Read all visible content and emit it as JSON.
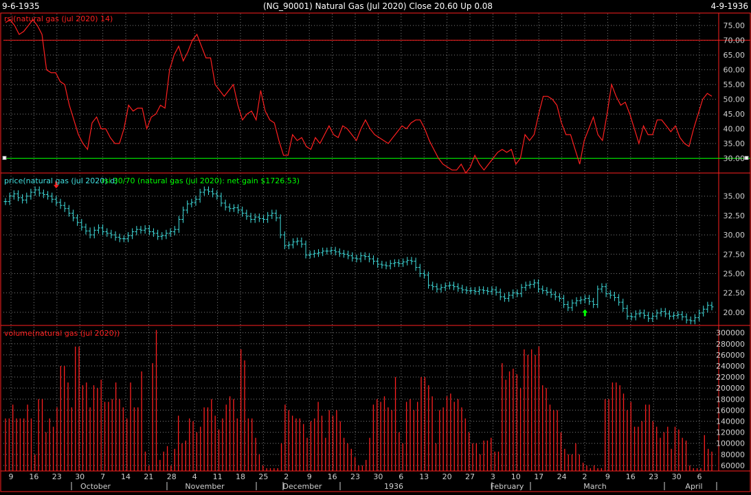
{
  "header": {
    "start_date": "9-6-1935",
    "title": "(NG_90001)  Natural Gas (Jul 2020)    Close 20.60   Up 0.08",
    "end_date": "4-9-1936"
  },
  "colors": {
    "background": "#000000",
    "frame": "#ff2020",
    "grid": "#7f7f7f",
    "rsi_line": "#ff2020",
    "price_bars": "#40e0e0",
    "volume_bars": "#ff2020",
    "threshold_upper": "#ff2020",
    "threshold_lower": "#00ff00",
    "sell_arrow": "#ff2020",
    "buy_arrow": "#00ff00"
  },
  "chart_data": [
    {
      "type": "line",
      "panel": "rsi",
      "title": "rsi(natural gas (jul 2020) 14)",
      "ylim": [
        25,
        79
      ],
      "ticks": [
        "75.00",
        "70.00",
        "65.00",
        "60.00",
        "55.00",
        "50.00",
        "45.00",
        "40.00",
        "35.00",
        "30.00"
      ],
      "thresholds": [
        70,
        30
      ],
      "values": [
        76,
        77,
        75,
        72,
        73,
        75,
        77,
        75,
        72,
        60,
        59,
        59,
        56,
        55,
        48,
        43,
        38,
        35,
        33,
        42,
        44,
        40,
        40,
        37,
        35,
        35,
        40,
        48,
        46,
        47,
        47,
        40,
        44,
        45,
        48,
        47,
        60,
        65,
        68,
        63,
        66,
        70,
        72,
        68,
        64,
        64,
        55,
        53,
        51,
        53,
        55,
        48,
        43,
        45,
        46,
        43,
        53,
        46,
        43,
        42,
        36,
        31,
        31,
        38,
        36,
        37,
        34,
        33,
        37,
        35,
        38,
        41,
        38,
        37,
        41,
        40,
        38,
        36,
        40,
        43,
        40,
        38,
        37,
        36,
        35,
        37,
        39,
        41,
        40,
        42,
        43,
        43,
        40,
        36,
        33,
        30,
        28,
        27,
        26,
        26,
        28,
        25,
        27,
        31,
        28,
        26,
        28,
        30,
        32,
        33,
        32,
        33,
        28,
        30,
        38,
        36,
        38,
        45,
        51,
        51,
        50,
        48,
        42,
        38,
        38,
        33,
        28,
        36,
        40,
        44,
        38,
        36,
        45,
        55,
        51,
        48,
        49,
        45,
        40,
        35,
        41,
        38,
        38,
        43,
        43,
        41,
        39,
        41,
        37,
        35,
        34,
        40,
        45,
        50,
        52,
        51
      ],
      "grid": true
    },
    {
      "type": "ohlc",
      "panel": "price",
      "title": "price(natural gas (jul 2020) d)",
      "subtitle": "rsi 30/70 (natural gas (jul 2020): net gain $1726.53)",
      "ylim": [
        18.3,
        37.9
      ],
      "ticks": [
        "35.00",
        "32.50",
        "30.00",
        "27.50",
        "25.00",
        "22.50",
        "20.00"
      ],
      "closes": [
        34.3,
        35.0,
        35.3,
        34.8,
        34.5,
        35.0,
        35.5,
        35.8,
        35.4,
        35.2,
        35.0,
        34.6,
        34.2,
        33.8,
        33.4,
        32.8,
        32.2,
        31.6,
        31.0,
        30.5,
        30.0,
        30.6,
        30.9,
        30.4,
        30.2,
        30.0,
        29.7,
        29.5,
        29.5,
        29.9,
        30.4,
        30.7,
        30.6,
        30.8,
        30.4,
        30.2,
        29.8,
        29.9,
        30.2,
        30.4,
        30.7,
        32.0,
        33.2,
        34.0,
        34.2,
        34.6,
        35.5,
        35.8,
        35.6,
        35.3,
        35.0,
        34.1,
        33.6,
        33.4,
        33.5,
        33.2,
        32.8,
        32.4,
        32.0,
        32.3,
        32.1,
        32.0,
        32.5,
        32.8,
        32.2,
        30.0,
        28.6,
        28.7,
        29.1,
        29.2,
        28.8,
        27.4,
        27.5,
        27.6,
        27.7,
        27.9,
        27.9,
        28.0,
        27.8,
        27.6,
        27.5,
        27.3,
        27.0,
        26.9,
        27.3,
        27.2,
        26.9,
        26.6,
        26.2,
        26.1,
        26.0,
        26.3,
        26.4,
        26.3,
        26.5,
        26.7,
        26.6,
        25.8,
        25.0,
        24.8,
        23.5,
        23.3,
        23.0,
        23.2,
        23.4,
        23.5,
        23.3,
        23.1,
        22.9,
        22.8,
        22.8,
        22.7,
        22.9,
        22.8,
        22.7,
        22.9,
        22.6,
        22.0,
        21.8,
        22.2,
        22.5,
        22.4,
        23.2,
        23.5,
        23.6,
        23.8,
        23.0,
        22.8,
        22.6,
        22.3,
        22.0,
        21.8,
        21.0,
        20.6,
        21.2,
        21.5,
        21.6,
        21.8,
        21.4,
        21.0,
        23.0,
        23.3,
        22.4,
        22.2,
        21.9,
        21.3,
        20.5,
        19.5,
        19.4,
        19.8,
        19.9,
        19.6,
        19.2,
        19.5,
        19.9,
        20.1,
        19.8,
        19.5,
        19.6,
        19.7,
        19.4,
        19.0,
        18.9,
        19.3,
        19.9,
        20.4,
        20.9,
        20.7
      ],
      "signals": [
        {
          "type": "sell",
          "bar": 12
        },
        {
          "type": "buy",
          "bar": 137
        }
      ],
      "grid": true
    },
    {
      "type": "bar",
      "panel": "volume",
      "title": "volume(natural gas (jul 2020))",
      "ylim": [
        50000,
        312000
      ],
      "ticks": [
        "300000",
        "280000",
        "260000",
        "240000",
        "220000",
        "200000",
        "180000",
        "160000",
        "140000",
        "120000",
        "100000",
        "80000",
        "60000"
      ],
      "values": [
        145000,
        145000,
        170000,
        145000,
        145000,
        145000,
        170000,
        145000,
        80000,
        180000,
        180000,
        120000,
        145000,
        130000,
        165000,
        240000,
        240000,
        210000,
        165000,
        275000,
        275000,
        205000,
        210000,
        165000,
        205000,
        200000,
        215000,
        175000,
        175000,
        180000,
        210000,
        180000,
        165000,
        145000,
        210000,
        165000,
        165000,
        230000,
        85000,
        60000,
        245000,
        305000,
        70000,
        85000,
        95000,
        60000,
        90000,
        150000,
        100000,
        105000,
        145000,
        140000,
        120000,
        130000,
        165000,
        165000,
        180000,
        150000,
        125000,
        145000,
        170000,
        185000,
        180000,
        145000,
        270000,
        250000,
        145000,
        145000,
        110000,
        80000,
        60000,
        55000,
        55000,
        55000,
        55000,
        100000,
        170000,
        160000,
        150000,
        145000,
        145000,
        135000,
        110000,
        140000,
        145000,
        175000,
        150000,
        110000,
        160000,
        150000,
        160000,
        140000,
        110000,
        100000,
        90000,
        75000,
        60000,
        60000,
        70000,
        110000,
        170000,
        180000,
        175000,
        185000,
        165000,
        160000,
        220000,
        120000,
        100000,
        175000,
        180000,
        160000,
        175000,
        220000,
        220000,
        205000,
        185000,
        100000,
        160000,
        165000,
        185000,
        190000,
        175000,
        180000,
        165000,
        145000,
        120000,
        100000,
        100000,
        80000,
        105000,
        105000,
        110000,
        85000,
        85000,
        245000,
        215000,
        230000,
        235000,
        225000,
        200000,
        270000,
        260000,
        270000,
        260000,
        275000,
        205000,
        200000,
        170000,
        160000,
        160000,
        120000,
        90000,
        80000,
        80000,
        100000,
        80000,
        65000,
        60000,
        55000,
        60000,
        55000,
        55000,
        180000,
        180000,
        210000,
        210000,
        205000,
        190000,
        160000,
        175000,
        130000,
        130000,
        140000,
        170000,
        170000,
        140000,
        130000,
        110000,
        120000,
        130000,
        90000,
        130000,
        125000,
        110000,
        105000,
        60000,
        55000,
        55000,
        55000,
        115000,
        90000,
        85000
      ],
      "grid": true
    }
  ],
  "x_axis": {
    "day_ticks": [
      "9",
      "16",
      "23",
      "30",
      "7",
      "14",
      "21",
      "28",
      "4",
      "11",
      "18",
      "25",
      "2",
      "9",
      "16",
      "23",
      "30",
      "6",
      "13",
      "20",
      "27",
      "3",
      "10",
      "17",
      "24",
      "2",
      "9",
      "16",
      "23",
      "30",
      "6"
    ],
    "month_labels": [
      "October",
      "November",
      "December",
      "1936",
      "February",
      "March",
      "April"
    ]
  }
}
